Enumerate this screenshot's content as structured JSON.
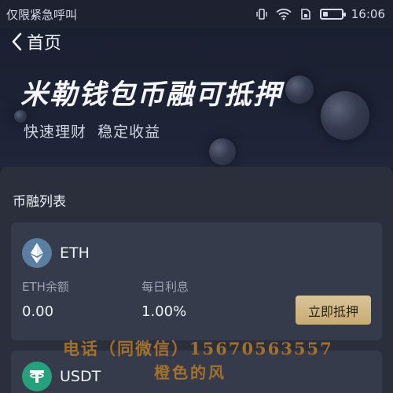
{
  "status_bar": {
    "carrier_text": "仅限紧急呼叫",
    "time": "16:06",
    "icons": [
      "vibrate-icon",
      "wifi-icon",
      "sim-icon",
      "battery-icon"
    ]
  },
  "header": {
    "back_label": "首页",
    "back_icon": "chevron-left-icon"
  },
  "hero": {
    "title": "米勒钱包币融可抵押",
    "subtitle": "快速理财  稳定收益"
  },
  "section": {
    "title": "币融列表"
  },
  "coins": [
    {
      "name": "ETH",
      "icon": "eth-logo-icon",
      "balance_label": "ETH余额",
      "balance_value": "0.00",
      "interest_label": "每日利息",
      "interest_value": "1.00%",
      "button_label": "立即抵押",
      "brand_color": "#5a7fa0"
    },
    {
      "name": "USDT",
      "icon": "usdt-logo-icon",
      "brand_color": "#26a17b"
    }
  ],
  "watermark": {
    "line1": "电话（同微信）15670563557",
    "line2": "橙色的风"
  },
  "colors": {
    "background": "#1e2230",
    "panel": "#2b2f3c",
    "card": "#363b4b",
    "accent_gold": "#d4bd8e",
    "watermark": "#b3792c"
  }
}
